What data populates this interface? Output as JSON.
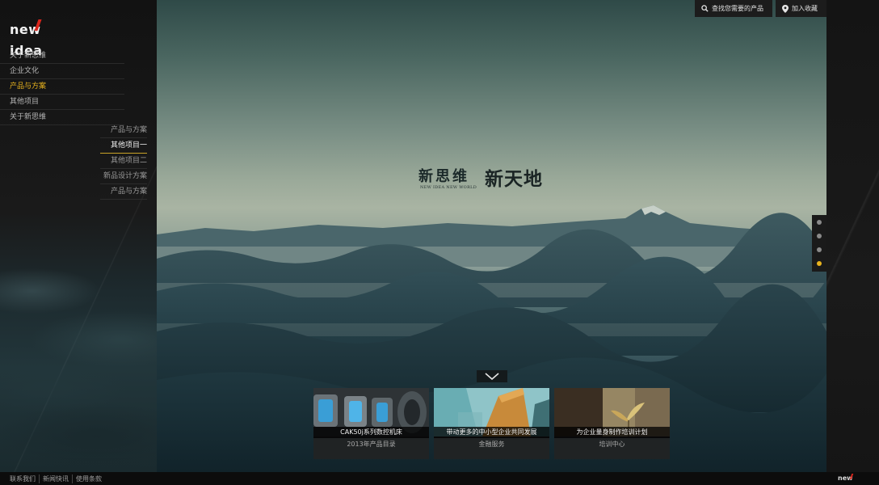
{
  "brand": {
    "logo_text": "new idea",
    "footer_logo_text": "new idea"
  },
  "main_nav": [
    {
      "label": "关于新思维",
      "active": false
    },
    {
      "label": "企业文化",
      "active": false
    },
    {
      "label": "产品与方案",
      "active": true
    },
    {
      "label": "其他项目",
      "active": false
    },
    {
      "label": "关于新思维",
      "active": false
    }
  ],
  "sub_nav": [
    {
      "label": "产品与方案",
      "active": false
    },
    {
      "label": "其他项目一",
      "active": true
    },
    {
      "label": "其他项目二",
      "active": false
    },
    {
      "label": "新品设计方案",
      "active": false
    },
    {
      "label": "产品与方案",
      "active": false
    }
  ],
  "top_buttons": {
    "search": "查找您需要的产品",
    "bookmark": "加入收藏"
  },
  "hero": {
    "slogan_left": "新思维",
    "slogan_right": "新天地",
    "slogan_sub": "NEW IDEA NEW WORLD"
  },
  "cards": [
    {
      "caption": "CAK50j系列数控机床",
      "sub": "2013年产品目录"
    },
    {
      "caption": "带动更多的中小型企业共同发展",
      "sub": "金融服务"
    },
    {
      "caption": "为企业量身制作培训计划",
      "sub": "培训中心"
    }
  ],
  "slider": {
    "count": 4,
    "active_index": 3
  },
  "footer_links": [
    "联系我们",
    "新闻快讯",
    "使用条款"
  ],
  "colors": {
    "accent": "#e8b31e",
    "brand_red": "#d9261c",
    "sidebar_bg": "#161616"
  }
}
